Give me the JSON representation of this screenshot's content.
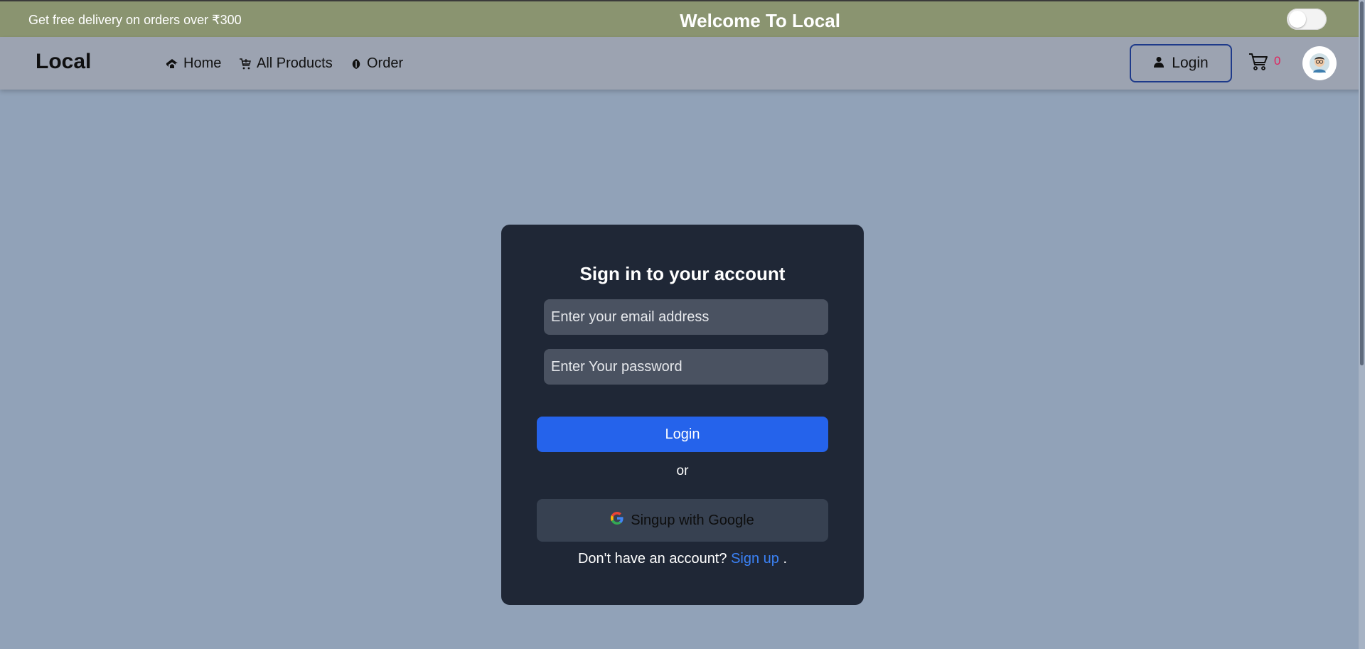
{
  "topbar": {
    "promo": "Get free delivery on orders over ₹300",
    "welcome": "Welcome To Local",
    "theme_toggle_on": false
  },
  "navbar": {
    "brand": "Local",
    "links": [
      {
        "label": "Home",
        "icon": "home-icon"
      },
      {
        "label": "All Products",
        "icon": "cart-add-icon"
      },
      {
        "label": "Order",
        "icon": "order-icon"
      }
    ],
    "login_label": "Login",
    "cart_count": "0"
  },
  "login_card": {
    "title": "Sign in to your account",
    "email_placeholder": "Enter your email address",
    "password_placeholder": "Enter Your password",
    "submit_label": "Login",
    "or_text": "or",
    "google_label": "Singup with Google",
    "no_account_text": "Don't have an account?",
    "signup_label": "Sign up",
    "trailing_period": "."
  },
  "colors": {
    "topbar_bg": "#8a9470",
    "navbar_bg": "#9ca3b1",
    "page_bg": "#91a2b8",
    "card_bg": "#1f2736",
    "primary": "#2563eb",
    "link": "#3b82f6",
    "cart_badge": "#e0245e"
  }
}
